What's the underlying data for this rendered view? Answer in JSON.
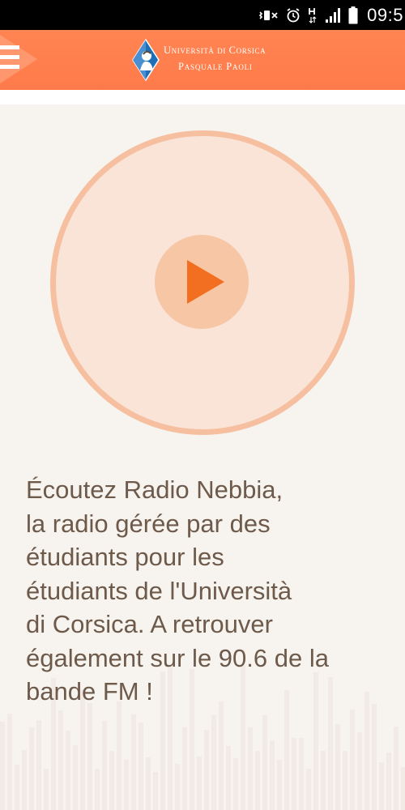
{
  "status_bar": {
    "time": "09:5",
    "icons": [
      "mute-vibrate-icon",
      "alarm-icon",
      "hplus-data-icon",
      "signal-icon",
      "battery-icon"
    ]
  },
  "app_bar": {
    "menu_icon": "hamburger-menu-icon",
    "logo": {
      "line1": "Università di Corsica",
      "line2": "Pasquale Paoli"
    },
    "color": "#ff7f50"
  },
  "player": {
    "play_icon": "play-icon",
    "accent": "#f26f21"
  },
  "description": {
    "lines": [
      "Écoutez Radio Nebbia,",
      "la radio gérée par des",
      "étudiants pour les",
      "étudiants de l'Università",
      "di Corsica. A retrouver",
      "également sur le 90.6 de la",
      "bande FM !"
    ]
  }
}
